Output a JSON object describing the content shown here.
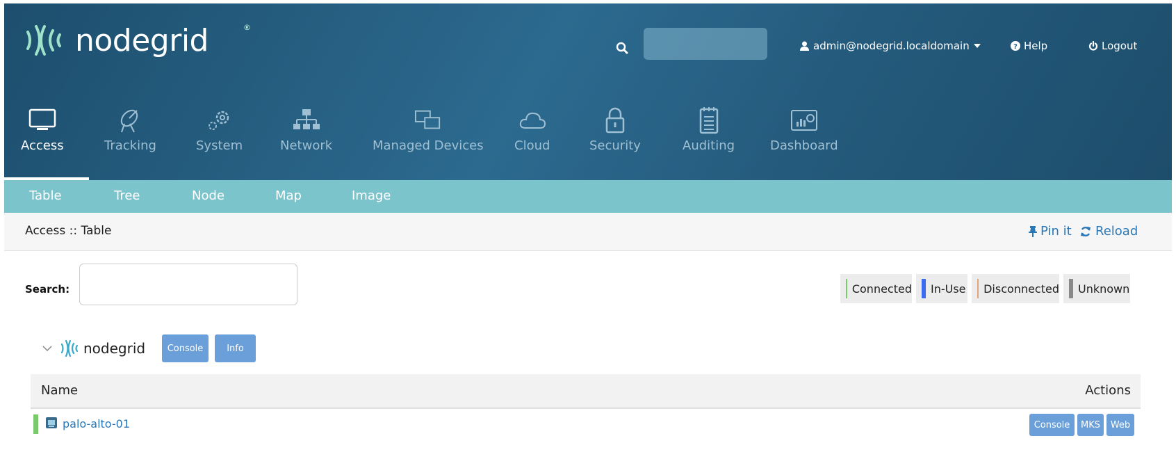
{
  "brand": {
    "name": "nodegrid",
    "registered": "®"
  },
  "header": {
    "search_placeholder": "",
    "user": "admin@nodegrid.localdomain",
    "help": "Help",
    "logout": "Logout"
  },
  "main_nav": [
    {
      "label": "Access",
      "icon": "monitor-icon"
    },
    {
      "label": "Tracking",
      "icon": "satellite-dish-icon"
    },
    {
      "label": "System",
      "icon": "gears-icon"
    },
    {
      "label": "Network",
      "icon": "network-tree-icon"
    },
    {
      "label": "Managed Devices",
      "icon": "device-windows-icon"
    },
    {
      "label": "Cloud",
      "icon": "cloud-icon"
    },
    {
      "label": "Security",
      "icon": "lock-icon"
    },
    {
      "label": "Auditing",
      "icon": "notepad-icon"
    },
    {
      "label": "Dashboard",
      "icon": "dashboard-icon"
    }
  ],
  "sub_nav": [
    "Table",
    "Tree",
    "Node",
    "Map",
    "Image"
  ],
  "breadcrumb": "Access :: Table",
  "actions": {
    "pin": "Pin it",
    "reload": "Reload"
  },
  "search": {
    "label": "Search:",
    "value": ""
  },
  "legend": [
    {
      "label": "Connected",
      "color": "#7ac96b"
    },
    {
      "label": "In-Use",
      "color": "#3c6cf0"
    },
    {
      "label": "Disconnected",
      "color": "#e0a47a"
    },
    {
      "label": "Unknown",
      "color": "#8a8a8a"
    }
  ],
  "group": {
    "name": "nodegrid",
    "console": "Console",
    "info": "Info"
  },
  "table": {
    "headers": {
      "name": "Name",
      "actions": "Actions"
    },
    "rows": [
      {
        "name": "palo-alto-01",
        "status": "Connected",
        "actions": [
          "Console",
          "MKS",
          "Web"
        ]
      }
    ]
  },
  "colors": {
    "accent": "#2b78b8",
    "subnav": "#7cc4cc",
    "button": "#6a9fd9"
  }
}
